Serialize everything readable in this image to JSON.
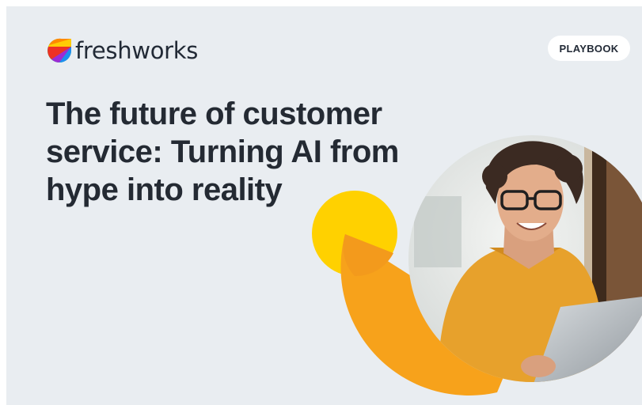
{
  "brand": {
    "name": "freshworks",
    "logo_icon": "freshworks-leaf-logo"
  },
  "badge": {
    "label": "PLAYBOOK"
  },
  "headline": {
    "line1": "The future of customer",
    "line2": "service: Turning AI from",
    "line3": "hype into reality"
  },
  "hero": {
    "image": "smiling woman with glasses using tablet",
    "accent_yellow": "#ffd100",
    "accent_orange": "#f7a21b",
    "sweater_color": "#e7a12c",
    "background": "#e9edf1"
  }
}
